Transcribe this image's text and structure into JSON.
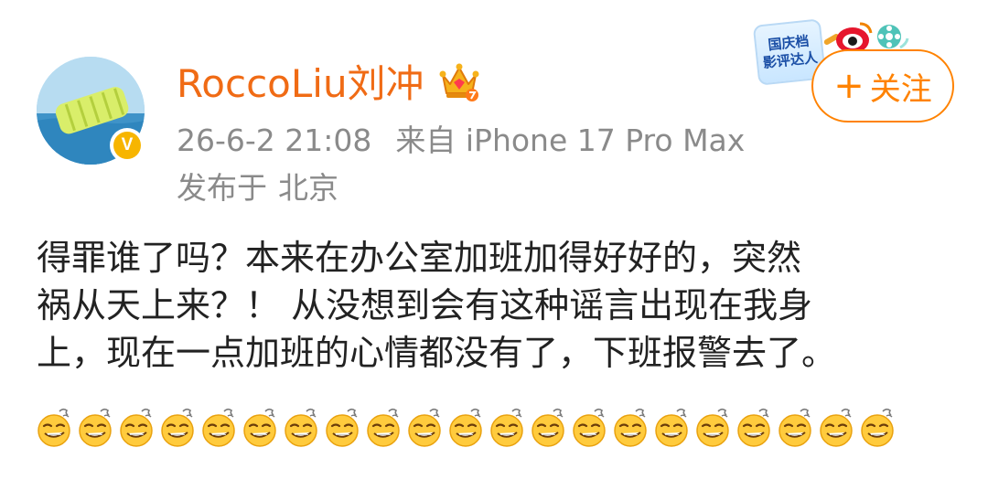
{
  "author": {
    "name": "RoccoLiu刘冲",
    "verified_badge": "V",
    "crown_icon": "crown-icon"
  },
  "meta": {
    "time": "26-6-2 21:08",
    "source": "来自 iPhone 17 Pro Max",
    "location_label": "发布于",
    "location": "北京"
  },
  "event_badge": {
    "line1": "国庆档",
    "line2": "影评达人"
  },
  "follow_button": {
    "plus": "+",
    "label": "关注"
  },
  "post": {
    "lines": [
      "得罪谁了吗？本来在办公室加班加得好好的，突然",
      "祸从天上来？！ 从没想到会有这种谣言出现在我身",
      "上，现在一点加班的心情都没有了，下班报警去了。"
    ],
    "emoji_icon": "grimace-smirk-emoji",
    "emoji_count": 21
  },
  "colors": {
    "username": "#f06b15",
    "follow": "#ff8200",
    "meta": "#8a8a8a",
    "text": "#222222"
  }
}
